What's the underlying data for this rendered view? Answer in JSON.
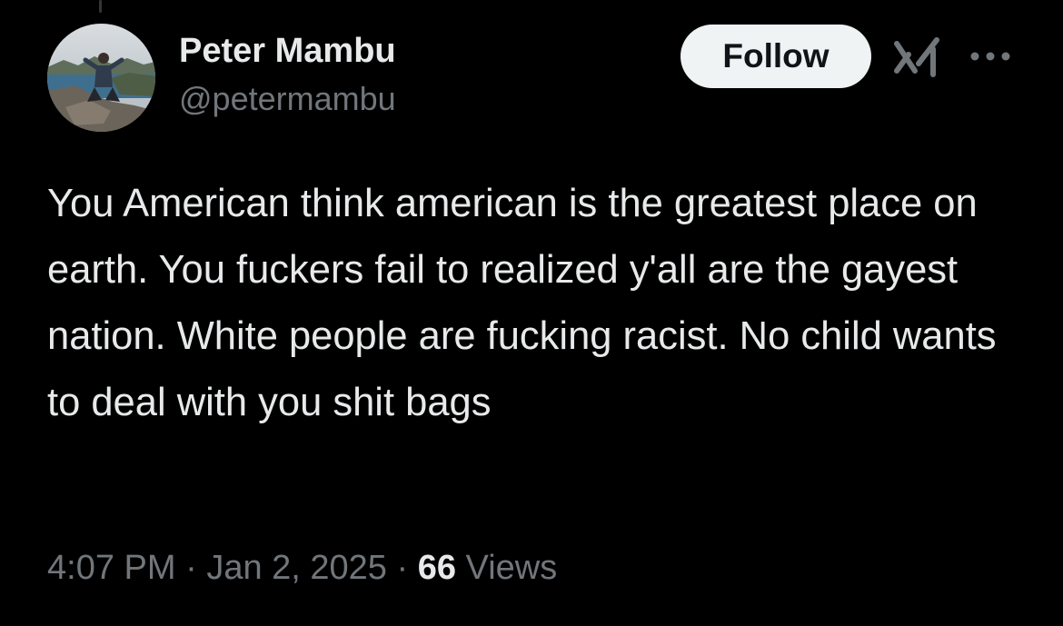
{
  "tweet": {
    "author": {
      "display_name": "Peter Mambu",
      "handle": "@petermambu",
      "avatar_icon": "profile-photo-person-on-mountain"
    },
    "follow_label": "Follow",
    "text": "You American think american is the greatest place on earth. You fuckers fail to realized y'all are the gayest nation. White people are fucking racist. No child wants to deal with you shit bags",
    "time": "4:07 PM",
    "date": "Jan 2, 2025",
    "separator": "·",
    "views_count": "66",
    "views_label": "Views"
  },
  "icons": {
    "grok": "grok-icon",
    "more": "more-dots-icon"
  },
  "colors": {
    "background": "#000000",
    "primary_text": "#e7e9ea",
    "secondary_text": "#71767b",
    "follow_button_bg": "#eff3f4",
    "follow_button_text": "#0f1419"
  }
}
